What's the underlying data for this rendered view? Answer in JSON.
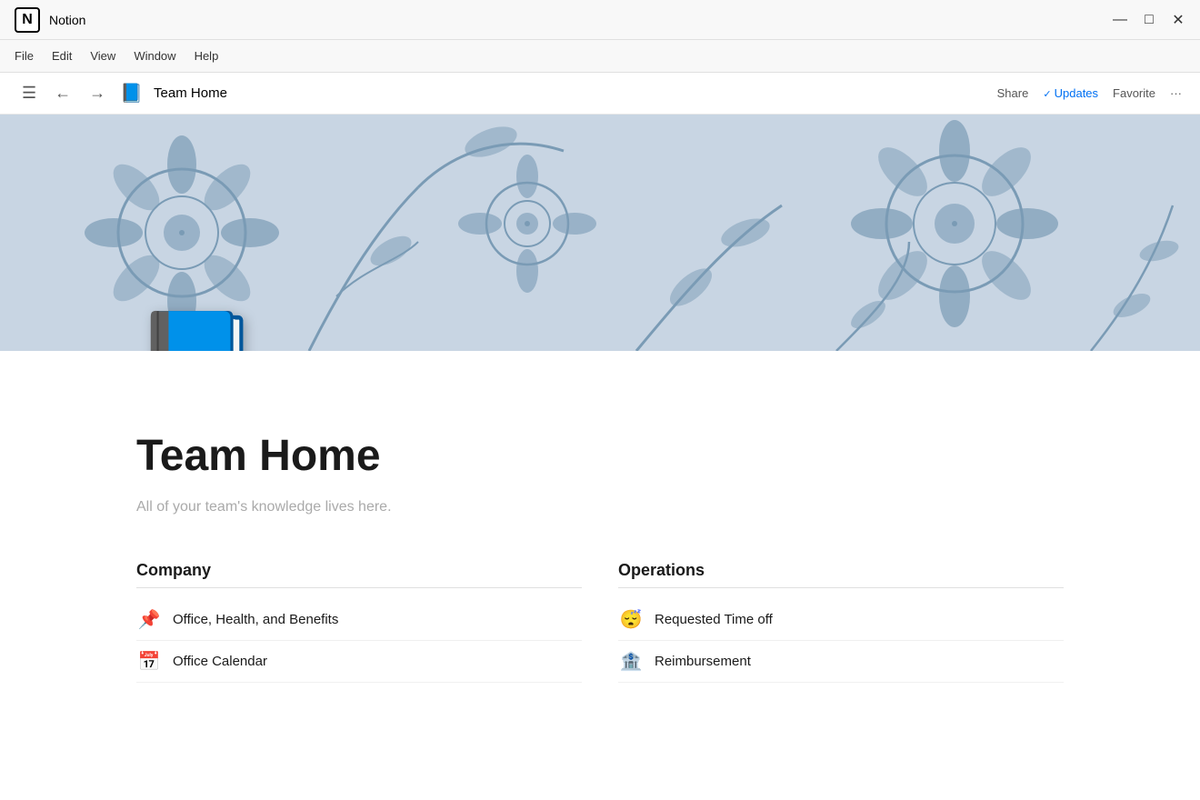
{
  "app": {
    "name": "Notion",
    "icon": "N"
  },
  "titlebar": {
    "minimize": "—",
    "maximize": "□",
    "close": "✕"
  },
  "menu": {
    "items": [
      "File",
      "Edit",
      "View",
      "Window",
      "Help"
    ]
  },
  "toolbar": {
    "menu_icon": "☰",
    "back_icon": "←",
    "forward_icon": "→",
    "page_title": "Team Home",
    "share_label": "Share",
    "updates_label": "Updates",
    "favorite_label": "Favorite",
    "more_icon": "···"
  },
  "page": {
    "title": "Team Home",
    "subtitle": "All of your team's knowledge lives here.",
    "icon_emoji": "📘"
  },
  "sections": [
    {
      "id": "company",
      "title": "Company",
      "items": [
        {
          "emoji": "📌",
          "text": "Office, Health, and Benefits"
        },
        {
          "emoji": "📅",
          "text": "Office Calendar"
        }
      ]
    },
    {
      "id": "operations",
      "title": "Operations",
      "items": [
        {
          "emoji": "😴",
          "text": "Requested Time off"
        },
        {
          "emoji": "🏦",
          "text": "Reimbursement"
        }
      ]
    }
  ]
}
